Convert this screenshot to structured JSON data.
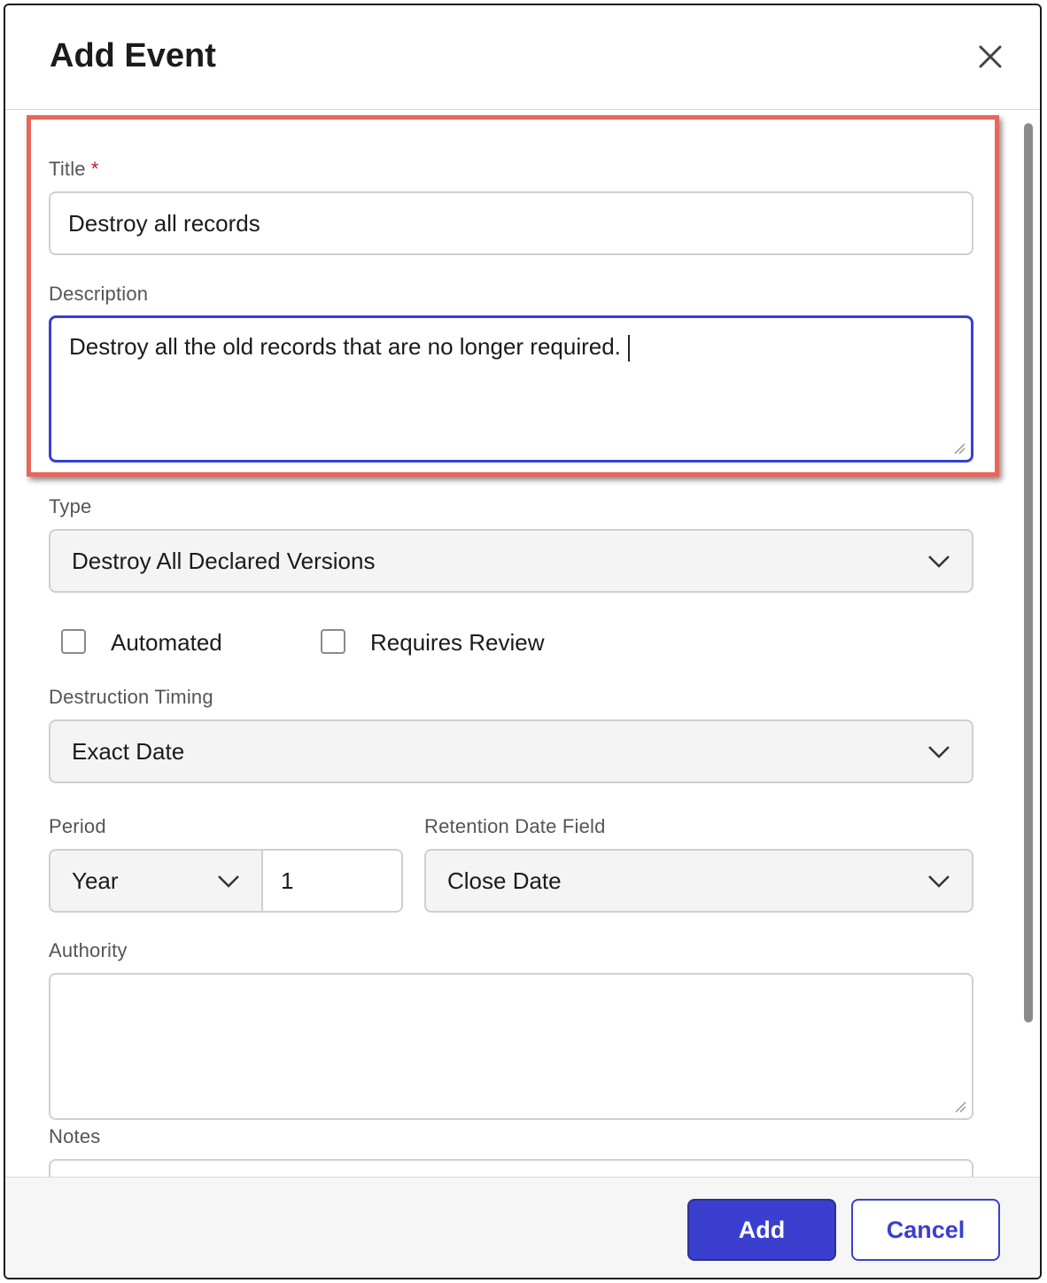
{
  "dialog": {
    "title": "Add Event",
    "close_icon": "close-icon"
  },
  "form": {
    "title": {
      "label": "Title",
      "required_mark": "*",
      "value": "Destroy all records"
    },
    "description": {
      "label": "Description",
      "value": "Destroy all the old records that are no longer required."
    },
    "type": {
      "label": "Type",
      "value": "Destroy All Declared Versions"
    },
    "automated": {
      "label": "Automated",
      "checked": false
    },
    "requires_review": {
      "label": "Requires Review",
      "checked": false
    },
    "destruction_timing": {
      "label": "Destruction Timing",
      "value": "Exact Date"
    },
    "period": {
      "label": "Period",
      "unit": "Year",
      "amount": "1"
    },
    "retention_date_field": {
      "label": "Retention Date Field",
      "value": "Close Date"
    },
    "authority": {
      "label": "Authority",
      "value": ""
    },
    "notes": {
      "label": "Notes",
      "value": ""
    }
  },
  "footer": {
    "add_label": "Add",
    "cancel_label": "Cancel"
  },
  "colors": {
    "primary": "#3a3fcf",
    "highlight": "#e8665a",
    "required": "#b0202a"
  }
}
